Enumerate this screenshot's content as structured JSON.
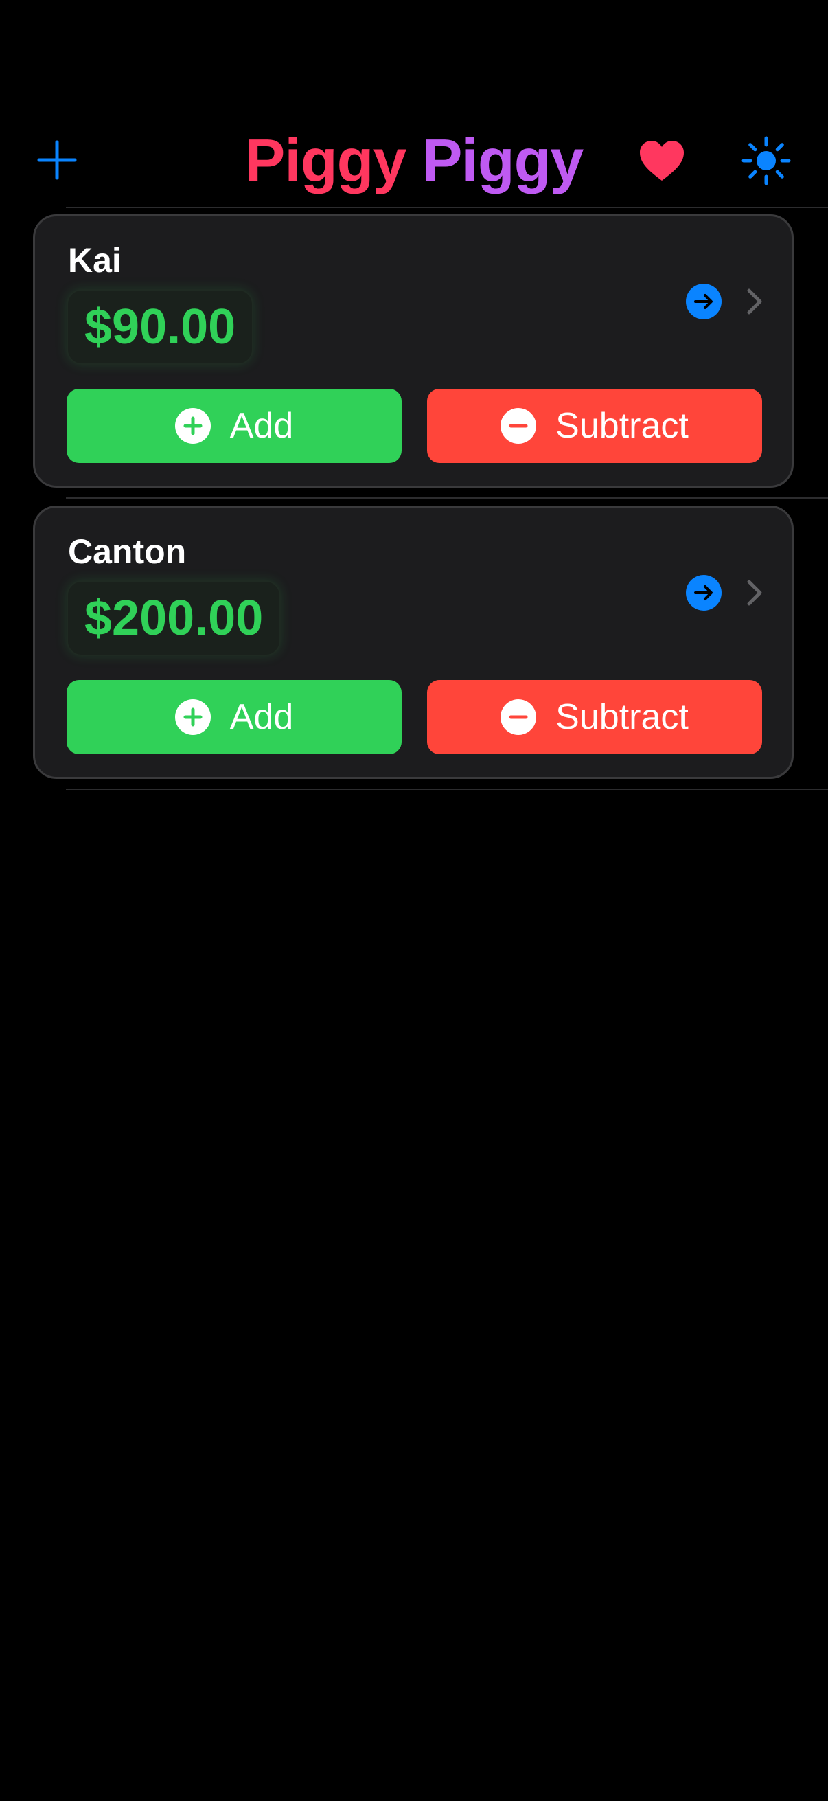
{
  "app": {
    "title_part_1": "Piggy",
    "title_part_2": "Piggy"
  },
  "toolbar": {
    "add_icon": "plus-icon",
    "favorite_icon": "heart-icon",
    "theme_icon": "sun-icon"
  },
  "accounts": [
    {
      "name": "Kai",
      "balance": "$90.00",
      "add_label": "Add",
      "subtract_label": "Subtract"
    },
    {
      "name": "Canton",
      "balance": "$200.00",
      "add_label": "Add",
      "subtract_label": "Subtract"
    }
  ],
  "colors": {
    "background": "#000000",
    "card": "#1c1c1e",
    "accent_blue": "#0a84ff",
    "balance_green": "#30d158",
    "add_green": "#30d158",
    "subtract_red": "#ff453a",
    "title_pink": "#ff375f",
    "title_purple": "#bf5af2",
    "heart_pink": "#ff375f"
  }
}
